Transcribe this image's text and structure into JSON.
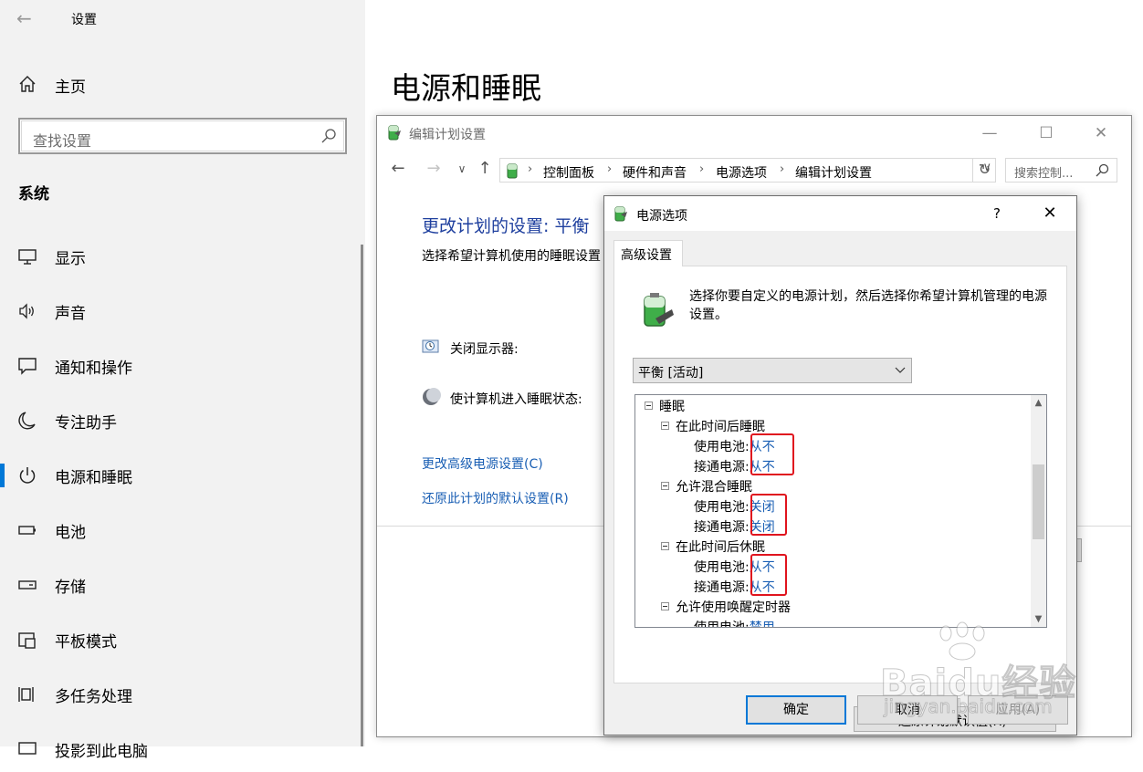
{
  "settings": {
    "app_title": "设置",
    "home_label": "主页",
    "search_placeholder": "查找设置",
    "section_title": "系统",
    "nav": [
      {
        "label": "显示",
        "icon": "monitor-icon"
      },
      {
        "label": "声音",
        "icon": "speaker-icon"
      },
      {
        "label": "通知和操作",
        "icon": "notification-icon"
      },
      {
        "label": "专注助手",
        "icon": "moon-icon"
      },
      {
        "label": "电源和睡眠",
        "icon": "power-icon",
        "active": true
      },
      {
        "label": "电池",
        "icon": "battery-icon"
      },
      {
        "label": "存储",
        "icon": "storage-icon"
      },
      {
        "label": "平板模式",
        "icon": "tablet-icon"
      },
      {
        "label": "多任务处理",
        "icon": "multitask-icon"
      },
      {
        "label": "投影到此电脑",
        "icon": "project-icon"
      }
    ],
    "page_title": "电源和睡眠",
    "accent_color": "#0078d7"
  },
  "edit_window": {
    "title": "编辑计划设置",
    "breadcrumb": [
      "控制面板",
      "硬件和声音",
      "电源选项",
      "编辑计划设置"
    ],
    "search_placeholder": "搜索控制...",
    "heading": "更改计划的设置: 平衡",
    "description": "选择希望计算机使用的睡眠设置",
    "display_off_label": "关闭显示器:",
    "sleep_label": "使计算机进入睡眠状态:",
    "links": [
      "更改高级电源设置(C)",
      "还原此计划的默认设置(R)"
    ]
  },
  "dialog": {
    "title": "电源选项",
    "help": "?",
    "tab": "高级设置",
    "description": "选择你要自定义的电源计划，然后选择你希望计算机管理的电源设置。",
    "plan_selected": "平衡 [活动]",
    "tree": {
      "root": "睡眠",
      "groups": [
        {
          "name": "在此时间后睡眠",
          "items": [
            {
              "label": "使用电池:",
              "value": "从不"
            },
            {
              "label": "接通电源:",
              "value": "从不"
            }
          ]
        },
        {
          "name": "允许混合睡眠",
          "items": [
            {
              "label": "使用电池:",
              "value": "关闭"
            },
            {
              "label": "接通电源:",
              "value": "关闭"
            }
          ]
        },
        {
          "name": "在此时间后休眠",
          "items": [
            {
              "label": "使用电池:",
              "value": "从不"
            },
            {
              "label": "接通电源:",
              "value": "从不"
            }
          ]
        },
        {
          "name": "允许使用唤醒定时器",
          "items": [
            {
              "label": "使用电池:",
              "value": "禁用"
            }
          ]
        }
      ]
    },
    "restore_button": "还原计划默认值(R)",
    "ok_button": "确定",
    "cancel_button": "取消",
    "apply_button": "应用(A)",
    "highlight_color": "#e0141e",
    "link_color": "#1a5fb4"
  },
  "watermark": {
    "brand": "Baidu经验",
    "sub": "jingyan.baidu.com"
  }
}
